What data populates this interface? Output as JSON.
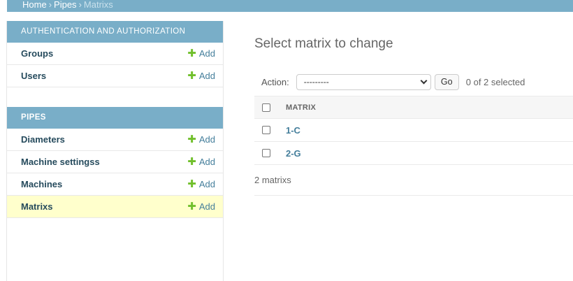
{
  "breadcrumbs": {
    "home": "Home",
    "sep1": "›",
    "app": "Pipes",
    "sep2": "›",
    "current": "Matrixs"
  },
  "sidebar": {
    "modules": [
      {
        "caption": "Authentication and Authorization",
        "models": [
          {
            "name": "Groups",
            "add": "Add"
          },
          {
            "name": "Users",
            "add": "Add"
          }
        ]
      },
      {
        "caption": "Pipes",
        "models": [
          {
            "name": "Diameters",
            "add": "Add"
          },
          {
            "name": "Machine settingss",
            "add": "Add"
          },
          {
            "name": "Machines",
            "add": "Add"
          },
          {
            "name": "Matrixs",
            "add": "Add"
          }
        ]
      }
    ]
  },
  "main": {
    "title": "Select matrix to change",
    "action_label": "Action:",
    "action_value": "---------",
    "go_label": "Go",
    "selected_counter": "0 of 2 selected",
    "column_header": "MATRIX",
    "rows": [
      "1-C",
      "2-G"
    ],
    "paginator": "2 matrixs"
  },
  "colors": {
    "header": "#79aec8",
    "link": "#447e9b",
    "add_plus": "#70bf2b",
    "selected_row": "#ffffcc"
  }
}
